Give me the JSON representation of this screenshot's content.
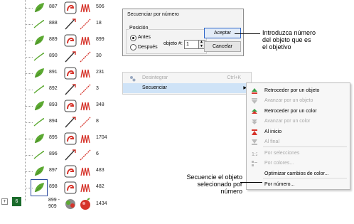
{
  "object_list": {
    "rows": [
      {
        "number": "887",
        "count": "506",
        "kind": "fill"
      },
      {
        "number": "888",
        "count": "18",
        "kind": "run"
      },
      {
        "number": "889",
        "count": "899",
        "kind": "fill"
      },
      {
        "number": "890",
        "count": "30",
        "kind": "run"
      },
      {
        "number": "891",
        "count": "231",
        "kind": "fill"
      },
      {
        "number": "892",
        "count": "3",
        "kind": "run"
      },
      {
        "number": "893",
        "count": "348",
        "kind": "fill"
      },
      {
        "number": "894",
        "count": "8",
        "kind": "run"
      },
      {
        "number": "895",
        "count": "1704",
        "kind": "fill"
      },
      {
        "number": "896",
        "count": "6",
        "kind": "run"
      },
      {
        "number": "897",
        "count": "483",
        "kind": "fill"
      },
      {
        "number": "898",
        "count": "482",
        "kind": "fill",
        "selected": true
      }
    ],
    "group": {
      "badge": "6",
      "expander": "+",
      "number_line1": "899 -",
      "number_line2": "909",
      "count": "1434"
    }
  },
  "dialog": {
    "title": "Secuenciar por número",
    "position_label": "Posición",
    "before_label": "Antes",
    "after_label": "Después",
    "selected_position": "Antes",
    "object_label": "objeto #:",
    "object_value": "1",
    "accept_label": "Aceptar",
    "cancel_label": "Cancelar"
  },
  "callouts": {
    "top_line1": "Introduzca número",
    "top_line2": "del objeto que es",
    "top_line3": "el objetivo",
    "bottom_line1": "Secuencie el objeto",
    "bottom_line2": "selecionado por",
    "bottom_line3": "número"
  },
  "context_menu": {
    "items": [
      {
        "label": "Desintegrar",
        "shortcut": "Ctrl+K",
        "disabled": true,
        "icon": "disintegrate-icon"
      },
      {
        "label": "Secuenciar",
        "shortcut": "",
        "disabled": false,
        "highlighted": true,
        "submenu": true
      }
    ]
  },
  "submenu": {
    "items": [
      {
        "label": "Retroceder por un objeto",
        "disabled": false,
        "icon": "back-one-object-icon"
      },
      {
        "label": "Avanzar por un objeto",
        "disabled": true,
        "icon": "forward-one-object-icon"
      },
      {
        "label": "Retroceder por un color",
        "disabled": false,
        "icon": "back-one-color-icon"
      },
      {
        "label": "Avanzar por un color",
        "disabled": true,
        "icon": "forward-one-color-icon"
      },
      {
        "label": "Al inicio",
        "disabled": false,
        "icon": "to-start-icon"
      },
      {
        "label": "Al final",
        "disabled": true,
        "icon": "to-end-icon"
      },
      {
        "label": "Por selecciones",
        "disabled": true,
        "icon": "by-selections-icon"
      },
      {
        "label": "Por colores...",
        "disabled": true,
        "icon": "by-colors-icon"
      },
      {
        "label": "Optimizar cambios de color...",
        "disabled": false,
        "icon": ""
      },
      {
        "label": "Por número...",
        "disabled": false,
        "icon": ""
      }
    ]
  },
  "colors": {
    "leaf_green": "#5ca932",
    "run_red": "#d6342b",
    "menu_highlight": "#cfe3f7",
    "group_badge": "#1a6b2b",
    "selection_border": "#2b4a9f"
  }
}
